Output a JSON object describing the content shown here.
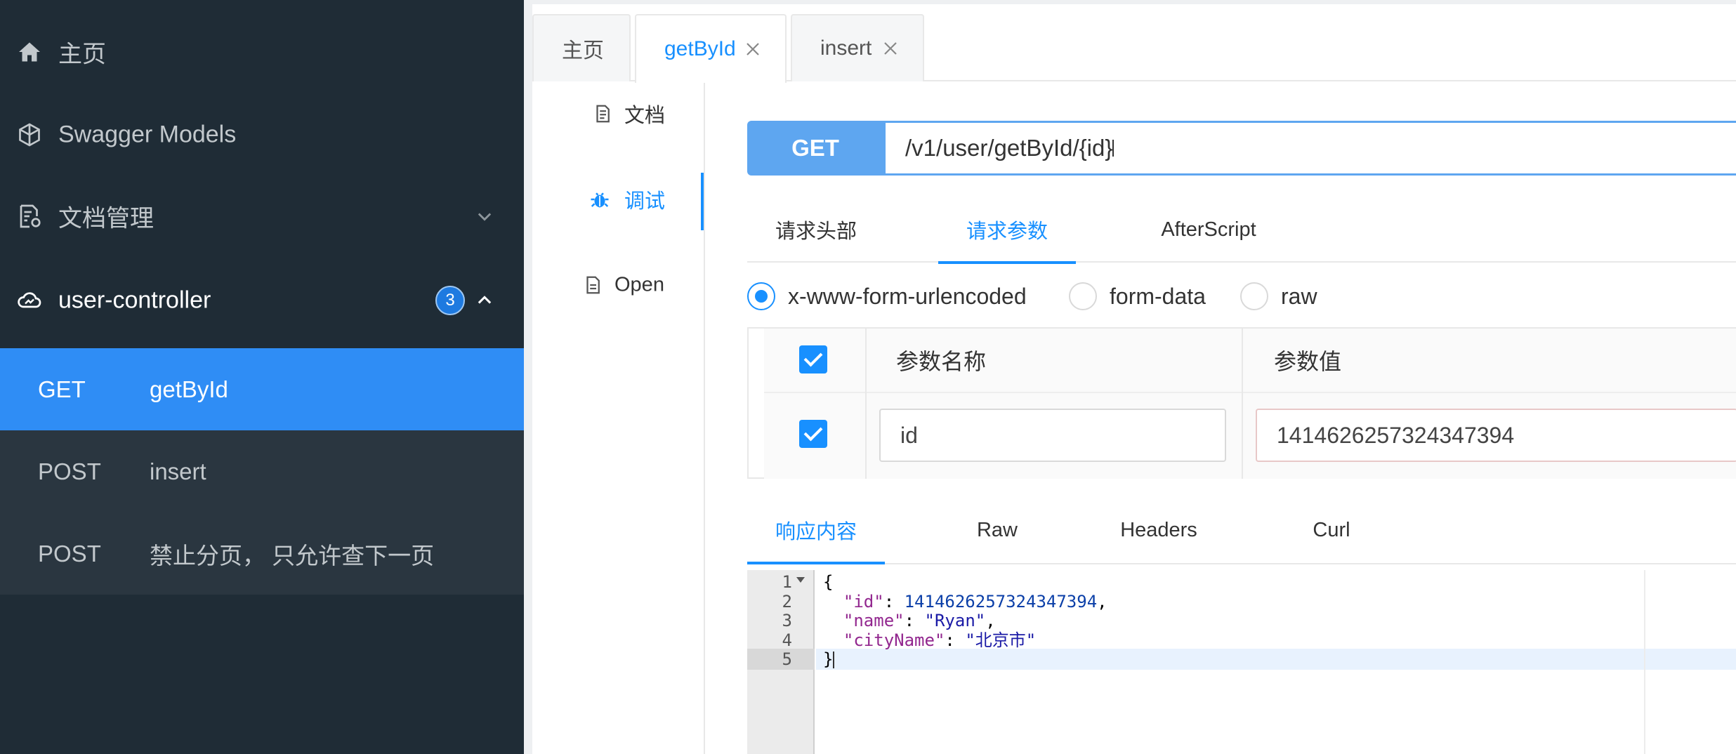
{
  "sidebar": {
    "home": {
      "label": "主页",
      "icon": "home-icon"
    },
    "models": {
      "label": "Swagger Models",
      "icon": "cube-icon"
    },
    "docs": {
      "label": "文档管理",
      "icon": "doc-settings-icon"
    },
    "controller": {
      "label": "user-controller",
      "icon": "cloud-icon",
      "badge": "3"
    },
    "endpoints": [
      {
        "method": "GET",
        "name": "getById"
      },
      {
        "method": "POST",
        "name": "insert"
      },
      {
        "method": "POST",
        "name": "禁止分页， 只允许查下一页"
      }
    ]
  },
  "tabs": [
    {
      "label": "主页"
    },
    {
      "label": "getById"
    },
    {
      "label": "insert"
    }
  ],
  "vmenu": {
    "doc": "文档",
    "debug": "调试",
    "open": "Open"
  },
  "request": {
    "method": "GET",
    "url": "/v1/user/getById/{id}",
    "tabs": [
      "请求头部",
      "请求参数",
      "AfterScript"
    ],
    "body_types": [
      "x-www-form-urlencoded",
      "form-data",
      "raw"
    ],
    "params": {
      "col_name": "参数名称",
      "col_value": "参数值",
      "rows": [
        {
          "name": "id",
          "value": "1414626257324347394"
        }
      ]
    }
  },
  "response": {
    "tabs": [
      "响应内容",
      "Raw",
      "Headers",
      "Curl"
    ],
    "lines": [
      "1",
      "2",
      "3",
      "4",
      "5"
    ],
    "json": {
      "open": "{",
      "id_key": "\"id\"",
      "id_val": "1414626257324347394",
      "name_key": "\"name\"",
      "name_val": "\"Ryan\"",
      "city_key": "\"cityName\"",
      "city_val": "\"北京市\"",
      "close": "}"
    }
  },
  "colors": {
    "sidebar_bg": "#1f2c36",
    "accent": "#1890ff",
    "active_item": "#2f8df5",
    "method_button": "#5ea6f0"
  }
}
